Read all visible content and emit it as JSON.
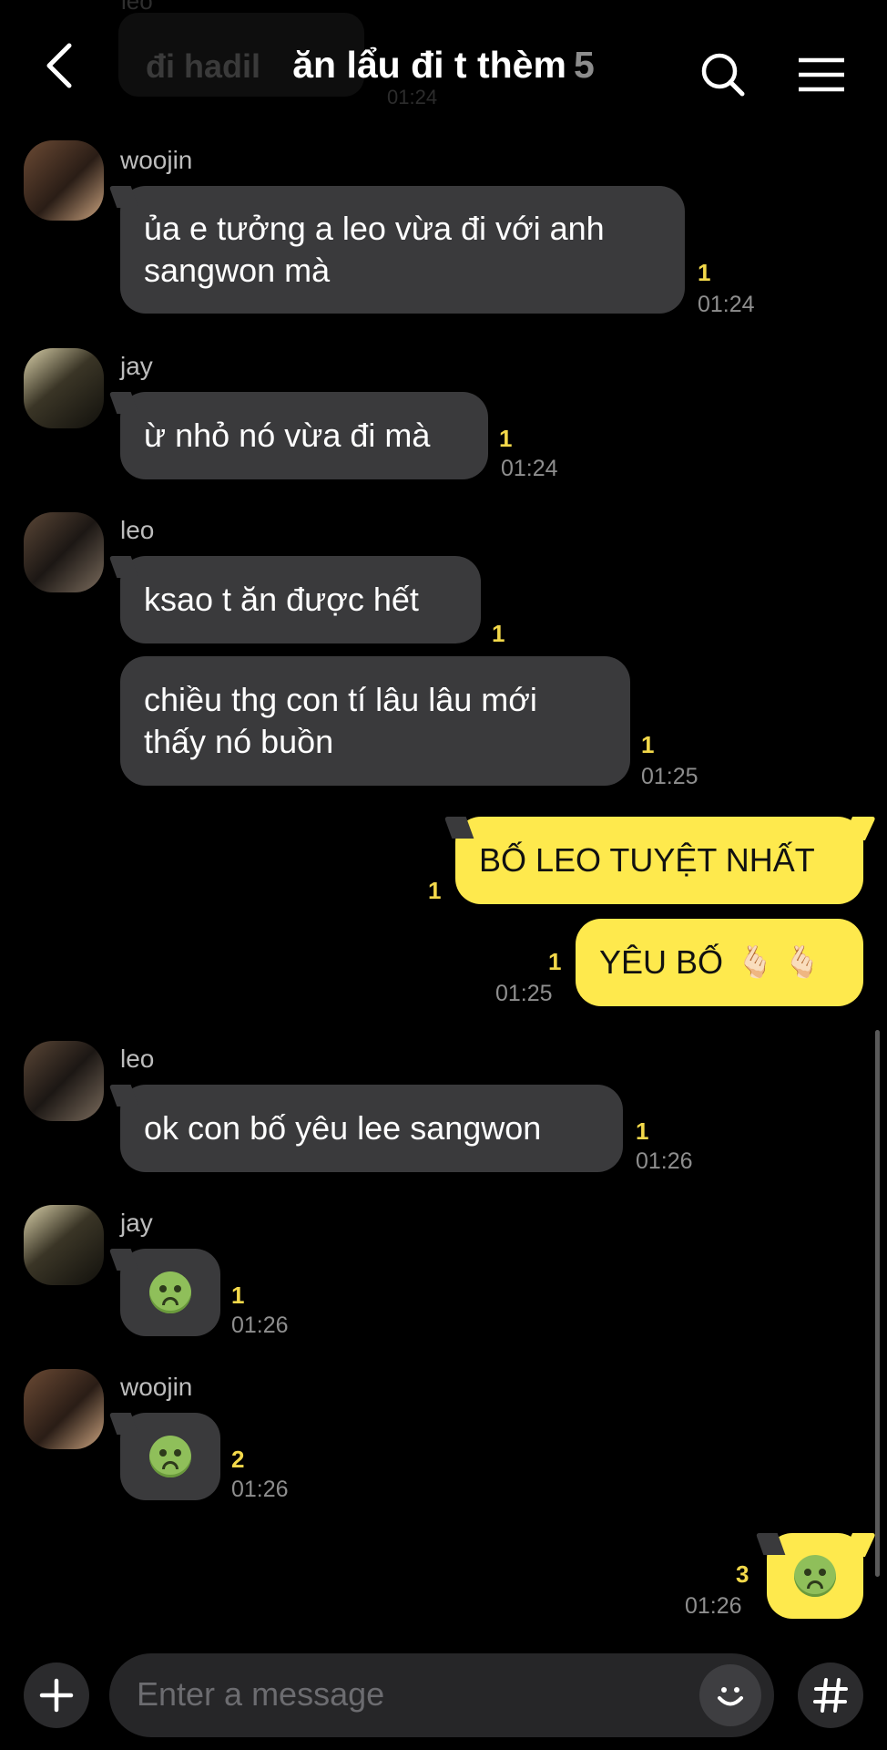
{
  "header": {
    "ghost_sender": "leo",
    "ghost_text": "đi hadil",
    "ghost_time": "01:24",
    "title": "ăn lẩu đi t thèm",
    "member_count": "5",
    "back_icon": "chevron-left-icon",
    "search_icon": "search-icon",
    "menu_icon": "hamburger-menu-icon"
  },
  "messages": [
    {
      "sender": "woojin",
      "text_l1": "ủa e tưởng a leo vừa đi với anh",
      "text_l2": "sangwon mà",
      "unread": "1",
      "time": "01:24"
    },
    {
      "sender": "jay",
      "text": "ừ nhỏ nó vừa đi mà",
      "unread": "1",
      "time": "01:24"
    },
    {
      "sender": "leo",
      "text": "ksao t ăn được hết",
      "unread": "1"
    },
    {
      "text_l1": "chiều thg con tí lâu lâu mới",
      "text_l2": "thấy nó buồn",
      "unread": "1",
      "time": "01:25"
    },
    {
      "mine": true,
      "text": "BỐ LEO TUYỆT NHẤT",
      "unread": "1"
    },
    {
      "mine": true,
      "text": "YÊU BỐ",
      "emoji": "🫰🏻 🫰🏻",
      "unread": "1",
      "time": "01:25"
    },
    {
      "sender": "leo",
      "text": "ok con bố yêu lee sangwon",
      "unread": "1",
      "time": "01:26"
    },
    {
      "sender": "jay",
      "emoji": "nauseated-face",
      "unread": "1",
      "time": "01:26"
    },
    {
      "sender": "woojin",
      "emoji": "nauseated-face",
      "unread": "2",
      "time": "01:26"
    },
    {
      "mine": true,
      "emoji": "nauseated-face",
      "unread": "3",
      "time": "01:26"
    }
  ],
  "composer": {
    "placeholder": "Enter a message",
    "plus_icon": "plus-icon",
    "emoji_icon": "smiley-icon",
    "hash_icon": "hashtag-icon"
  },
  "colors": {
    "background": "#000000",
    "their_bubble": "#3a3a3c",
    "my_bubble": "#fee94d",
    "unread_count": "#f2d84a",
    "timestamp": "#8e8e8e"
  }
}
